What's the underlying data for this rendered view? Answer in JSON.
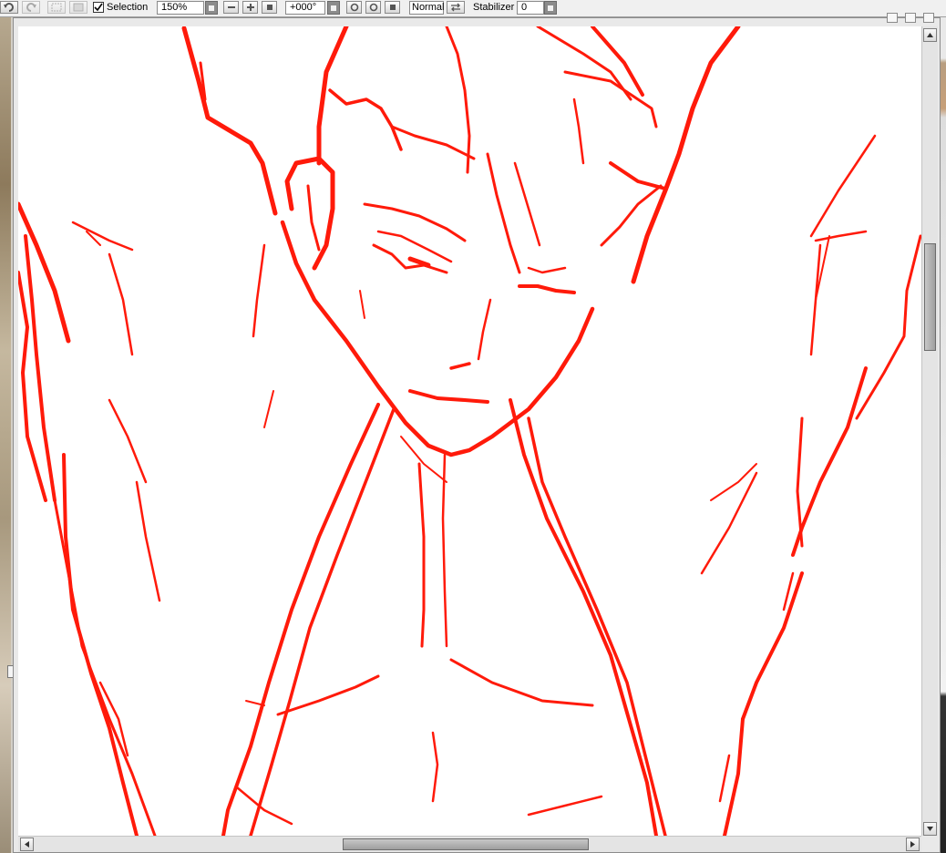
{
  "toolbar": {
    "selection_label": "Selection",
    "selection_checked": true,
    "zoom_value": "150%",
    "rotation_value": "+000°",
    "blend_mode": "Normal",
    "stabilizer_label": "Stabilizer",
    "stabilizer_value": "0",
    "icons": [
      "undo-icon",
      "redo-icon",
      "deselect-icon",
      "select-inverse-icon",
      "zoom-out-icon",
      "zoom-in-icon",
      "zoom-reset-icon",
      "rotate-left-icon",
      "rotate-right-icon",
      "rotate-reset-icon",
      "flip-horizontal-icon"
    ]
  },
  "canvas": {
    "stroke_color": "#ff1a0a",
    "background_color": "#ffffff"
  },
  "scrollbars": {
    "vertical_position": 0.3,
    "horizontal_position": 0.37
  }
}
